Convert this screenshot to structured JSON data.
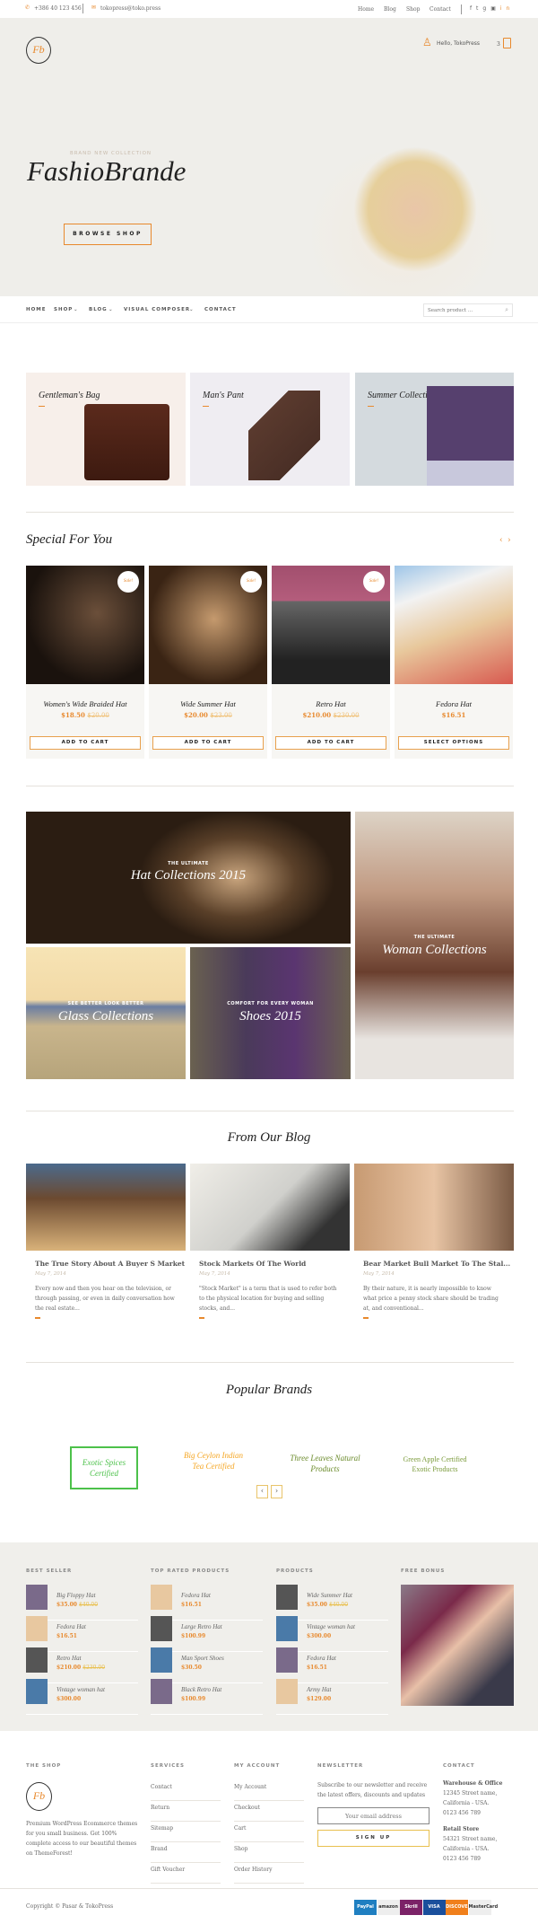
{
  "topbar": {
    "phone": "+386 40 123 456",
    "email": "tokopress@toko.press",
    "links": [
      "Home",
      "Blog",
      "Shop",
      "Contact"
    ],
    "social_icons": [
      "facebook-icon",
      "twitter-icon",
      "google-plus-icon",
      "instagram-icon",
      "linkedin-icon"
    ]
  },
  "header": {
    "logo": "Fb",
    "user_greeting": "Hello, TokoPress",
    "cart_count": "3"
  },
  "hero": {
    "kicker": "BRAND NEW COLLECTION",
    "title": "FashioBrande",
    "button": "BROWSE SHOP"
  },
  "nav": {
    "items": [
      "HOME",
      "SHOP",
      "BLOG",
      "VISUAL COMPOSER",
      "CONTACT"
    ],
    "search_placeholder": "Search product ..."
  },
  "categories": [
    {
      "label": "Gentleman's Bag"
    },
    {
      "label": "Man's Pant"
    },
    {
      "label": "Summer Collection"
    }
  ],
  "special": {
    "title": "Special For You",
    "products": [
      {
        "name": "Women's Wide Braided Hat",
        "price": "$18.50",
        "old": "$20.00",
        "sale": "Sale!",
        "button": "ADD TO CART"
      },
      {
        "name": "Wide Summer Hat",
        "price": "$20.00",
        "old": "$23.00",
        "sale": "Sale!",
        "button": "ADD TO CART"
      },
      {
        "name": "Retro Hat",
        "price": "$210.00",
        "old": "$230.00",
        "sale": "Sale!",
        "button": "ADD TO CART"
      },
      {
        "name": "Fedora Hat",
        "price": "$16.51",
        "button": "SELECT OPTIONS"
      }
    ]
  },
  "collections": [
    {
      "sub": "THE ULTIMATE",
      "title": "Hat Collections 2015"
    },
    {
      "sub": "SEE BETTER LOOK BETTER",
      "title": "Glass Collections"
    },
    {
      "sub": "COMFORT FOR EVERY WOMAN",
      "title": "Shoes 2015"
    },
    {
      "sub": "THE ULTIMATE",
      "title": "Woman Collections"
    }
  ],
  "blog": {
    "title": "From Our Blog",
    "posts": [
      {
        "title": "The True Story About A Buyer S Market",
        "date": "May 7, 2014",
        "excerpt": "Every now and then you hear on the television, or through passing, or even in daily conversation how the real estate..."
      },
      {
        "title": "Stock Markets Of The World",
        "date": "May 7, 2014",
        "excerpt": "\"Stock Market\" is a term that is used to refer both to the physical location for buying and selling stocks, and..."
      },
      {
        "title": "Bear Market Bull Market To The Stal...",
        "date": "May 7, 2014",
        "excerpt": "By their nature, it is nearly impossible to know what price a penny stock share should be trading at, and conventional..."
      }
    ]
  },
  "brands": {
    "title": "Popular Brands",
    "logos": [
      "Exotic Spices Certified",
      "Big Ceylon Indian Tea Certified",
      "Three Leaves Natural Products",
      "Green Apple Certified Exotic Products"
    ]
  },
  "widgets": [
    {
      "title": "BEST SELLER",
      "items": [
        {
          "name": "Big Floppy Hat",
          "price": "$35.00",
          "old": "$40.00"
        },
        {
          "name": "Fedora Hat",
          "price": "$16.51"
        },
        {
          "name": "Retro Hat",
          "price": "$210.00",
          "old": "$230.00"
        },
        {
          "name": "Vintage woman hat",
          "price": "$300.00"
        }
      ]
    },
    {
      "title": "TOP RATED PRODUCTS",
      "items": [
        {
          "name": "Fedora Hat",
          "price": "$16.51"
        },
        {
          "name": "Large Retro Hat",
          "price": "$100.99"
        },
        {
          "name": "Man Sport Shoes",
          "price": "$30.50"
        },
        {
          "name": "Black Retro Hat",
          "price": "$100.99"
        }
      ]
    },
    {
      "title": "PRODUCTS",
      "items": [
        {
          "name": "Wide Summer Hat",
          "price": "$35.00",
          "old": "$40.00"
        },
        {
          "name": "Vintage woman hat",
          "price": "$300.00"
        },
        {
          "name": "Fedora Hat",
          "price": "$16.51"
        },
        {
          "name": "Army Hat",
          "price": "$129.00"
        }
      ]
    }
  ],
  "free_bonus": {
    "title": "FREE BONUS"
  },
  "footer": {
    "shop": {
      "title": "THE SHOP",
      "text": "Premium WordPress Ecommerce themes for you small business. Get 100% complete access to our beautiful themes on ThemeForest!"
    },
    "services": {
      "title": "SERVICES",
      "links": [
        "Contact",
        "Return",
        "Sitemap",
        "Brand",
        "Gift Voucher"
      ]
    },
    "account": {
      "title": "MY ACCOUNT",
      "links": [
        "My Account",
        "Checkout",
        "Cart",
        "Shop",
        "Order History"
      ]
    },
    "newsletter": {
      "title": "NEWSLETTER",
      "text": "Subscribe to our newsletter and receive the latest offers, discounts and updates",
      "placeholder": "Your email address",
      "button": "SIGN UP"
    },
    "contact": {
      "title": "CONTACT",
      "blocks": [
        {
          "name": "Warehouse & Office",
          "lines": [
            "12345 Street name,",
            "California - USA.",
            "0123 456 789"
          ]
        },
        {
          "name": "Retail Store",
          "lines": [
            "54321 Street name,",
            "California - USA.",
            "0123 456 789"
          ]
        }
      ]
    },
    "copyright": "Copyright © Pasar & TokoPress",
    "payments": [
      {
        "name": "PayPal",
        "color": "#1f7fc1"
      },
      {
        "name": "amazon",
        "color": "#eeeeee"
      },
      {
        "name": "Skrill",
        "color": "#7b2267"
      },
      {
        "name": "VISA",
        "color": "#1a4f9c"
      },
      {
        "name": "DISCOVER",
        "color": "#f07f1b"
      },
      {
        "name": "MasterCard",
        "color": "#eeeeee"
      }
    ]
  },
  "colors": {
    "accent": "#e8892d",
    "hero_bg": "#efeeea",
    "footer_bg": "#f0efeb"
  }
}
